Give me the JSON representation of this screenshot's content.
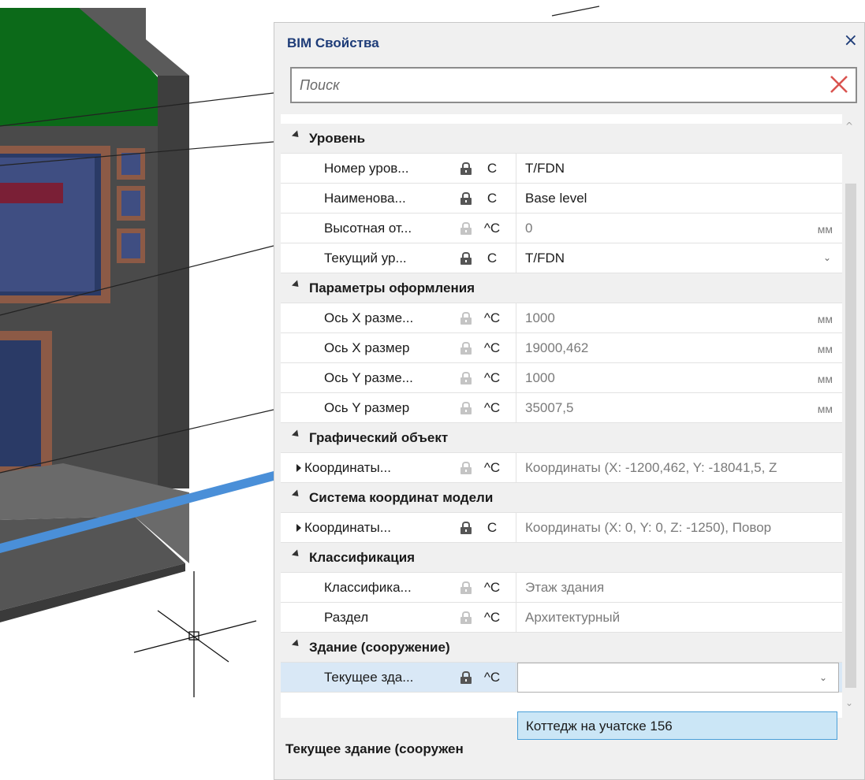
{
  "panel": {
    "title": "BIM Свойства",
    "close_glyph": "×",
    "search_placeholder": "Поиск",
    "description": "Текущее здание (сооружен",
    "dropdown_option": "Коттедж на учатске 156",
    "icons": {
      "close": "close-icon",
      "clear": "clear-search-icon",
      "lock": "lock-icon",
      "scroll_up": "scroll-up-icon",
      "scroll_down": "scroll-down-icon"
    },
    "colors": {
      "title": "#1e3c78",
      "clear_x": "#d9534f",
      "selection": "#d9e8f6",
      "popup": "#cbe6f6",
      "popup_border": "#4a9fd8"
    }
  },
  "categories": [
    {
      "name": "Уровень",
      "rows": [
        {
          "name": "Номер уров...",
          "lock": "dark",
          "mark": "C",
          "value": "T/FDN",
          "unit": "",
          "value_style": "normal",
          "dropdown": false
        },
        {
          "name": "Наименова...",
          "lock": "dark",
          "mark": "C",
          "value": "Base level",
          "unit": "",
          "value_style": "normal",
          "dropdown": false
        },
        {
          "name": "Высотная от...",
          "lock": "dim",
          "mark": "^C",
          "value": "0",
          "unit": "мм",
          "value_style": "gray",
          "dropdown": false
        },
        {
          "name": "Текущий ур...",
          "lock": "dark",
          "mark": "C",
          "value": "T/FDN",
          "unit": "",
          "value_style": "normal",
          "dropdown": true
        }
      ]
    },
    {
      "name": "Параметры оформления",
      "rows": [
        {
          "name": "Ось X разме...",
          "lock": "dim",
          "mark": "^C",
          "value": "1000",
          "unit": "мм",
          "value_style": "gray",
          "dropdown": false
        },
        {
          "name": "Ось X размер",
          "lock": "dim",
          "mark": "^C",
          "value": "19000,462",
          "unit": "мм",
          "value_style": "gray",
          "dropdown": false
        },
        {
          "name": "Ось Y разме...",
          "lock": "dim",
          "mark": "^C",
          "value": "1000",
          "unit": "мм",
          "value_style": "gray",
          "dropdown": false
        },
        {
          "name": "Ось Y размер",
          "lock": "dim",
          "mark": "^C",
          "value": "35007,5",
          "unit": "мм",
          "value_style": "gray",
          "dropdown": false
        }
      ]
    },
    {
      "name": "Графический объект",
      "rows": [
        {
          "name": "Координаты...",
          "lock": "dim",
          "mark": "^C",
          "value": "Координаты (X: -1200,462, Y: -18041,5, Z",
          "unit": "",
          "value_style": "gray",
          "dropdown": false,
          "expandable": true
        }
      ]
    },
    {
      "name": "Система координат модели",
      "rows": [
        {
          "name": "Координаты...",
          "lock": "dark",
          "mark": "C",
          "value": "Координаты (X: 0, Y: 0, Z: -1250), Повор",
          "unit": "",
          "value_style": "gray",
          "dropdown": false,
          "expandable": true
        }
      ]
    },
    {
      "name": "Классификация",
      "rows": [
        {
          "name": "Классифика...",
          "lock": "dim",
          "mark": "^C",
          "value": "Этаж здания",
          "unit": "",
          "value_style": "gray",
          "dropdown": false
        },
        {
          "name": "Раздел",
          "lock": "dim",
          "mark": "^C",
          "value": "Архитектурный",
          "unit": "",
          "value_style": "gray",
          "dropdown": false
        }
      ]
    },
    {
      "name": "Здание (сооружение)",
      "rows": [
        {
          "name": "Текущее зда...",
          "lock": "dark",
          "mark": "^C",
          "value": "",
          "unit": "",
          "value_style": "normal",
          "dropdown": true,
          "selected": true
        }
      ]
    }
  ]
}
